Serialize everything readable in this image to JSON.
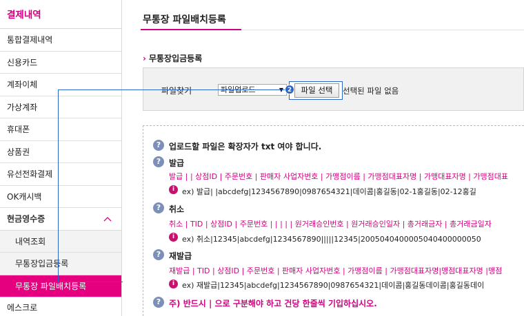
{
  "sidebar": {
    "title": "결제내역",
    "items": [
      {
        "label": "통합결제내역"
      },
      {
        "label": "신용카드"
      },
      {
        "label": "계좌이체"
      },
      {
        "label": "가상계좌"
      },
      {
        "label": "휴대폰"
      },
      {
        "label": "상품권"
      },
      {
        "label": "유선전화결제"
      },
      {
        "label": "OK캐시백"
      }
    ],
    "parent": {
      "label": "현금영수증",
      "chevron": "^"
    },
    "sub_items": [
      {
        "label": "내역조회"
      },
      {
        "label": "무통장입금등록"
      },
      {
        "label": "무통장 파일배치등록"
      }
    ],
    "bottom_item": "에스크로"
  },
  "main": {
    "title": "무통장 파일배치등록",
    "section_title": "무통장입금등록",
    "section_arrow": "›",
    "upload": {
      "label": "파일찾기",
      "select_value": "파일업로드",
      "select_arrow": "▼",
      "file_button": "파일 선택",
      "file_status": "선택된 파일 없음",
      "badge": "2"
    }
  },
  "info": {
    "q_glyph": "?",
    "e_glyph": "i",
    "notice": "업로드할 파일은 확장자가 txt 여야 합니다.",
    "issue": {
      "heading": "발급",
      "fields": "발급 | | 상점ID | 주문번호 | 판매자 사업자번호 | 가맹점이름 | 가맹점대표자명 | 가맹대표자명 | 가맹점대표",
      "example": "ex) 발급| |abcdefg|1234567890|0987654321|데이콤|홍길동|02-1홍길동|02-12홍길"
    },
    "cancel": {
      "heading": "취소",
      "fields": "취소 | TID | 상점ID | 주문번호 | | | | | 원거래승인번호 | 원거래승인일자 | 총거래금자 | 총거래금일자",
      "example": "ex) 취소|12345|abcdefg|1234567890|||||12345|2005040400005040400000050"
    },
    "reissue": {
      "heading": "재발급",
      "fields": "재발급 | TID | 상점ID | 주문번호 | 판매자 사업자번호 | 가맹점이름 | 가맹점대표자명|맹점대표자명 |맹점",
      "example": "ex) 재발급|12345|abcdefg|1234567890|0987654321|데이콤|홍길동데이콤|홍길동데이"
    },
    "warning": "주) 반드시 | 으로 구분해야 하고 건당 한줄씩 기입하십시오."
  }
}
